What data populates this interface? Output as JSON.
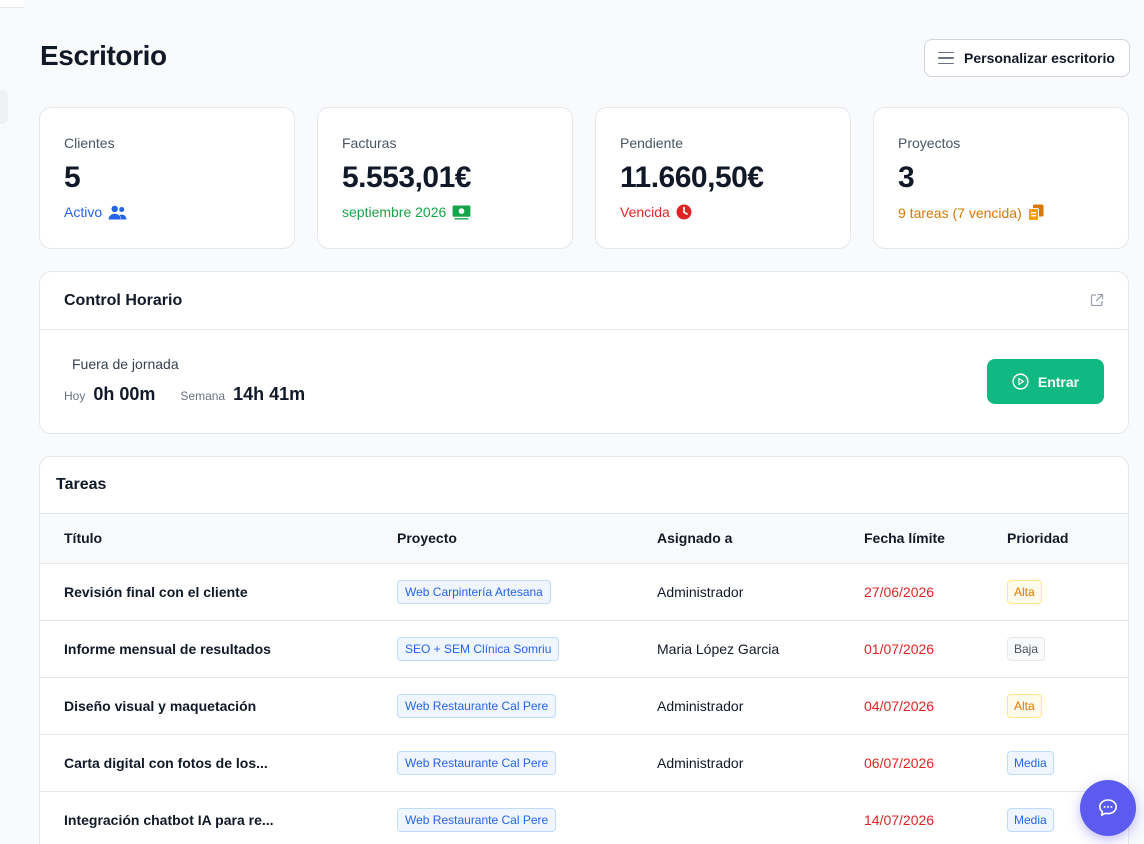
{
  "page": {
    "title": "Escritorio",
    "customize_label": "Personalizar escritorio"
  },
  "stats": [
    {
      "label": "Clientes",
      "value": "5",
      "sub": "Activo",
      "icon": "users-icon",
      "color": "#2563eb"
    },
    {
      "label": "Facturas",
      "value": "5.553,01€",
      "sub": "septiembre 2026",
      "icon": "money-bill-icon",
      "color": "#16a34a"
    },
    {
      "label": "Pendiente",
      "value": "11.660,50€",
      "sub": "Vencida",
      "icon": "clock-icon",
      "color": "#dc2626"
    },
    {
      "label": "Proyectos",
      "value": "3",
      "sub": "9 tareas (7 vencida)",
      "icon": "copy-icon",
      "color": "#d97706"
    }
  ],
  "time_control": {
    "title": "Control Horario",
    "status": "Fuera de jornada",
    "today_label": "Hoy",
    "today_value": "0h 00m",
    "week_label": "Semana",
    "week_value": "14h 41m",
    "enter_label": "Entrar"
  },
  "tasks": {
    "title": "Tareas",
    "columns": [
      "Título",
      "Proyecto",
      "Asignado a",
      "Fecha límite",
      "Prioridad"
    ],
    "rows": [
      {
        "title": "Revisión final con el cliente",
        "project": "Web Carpintería Artesana",
        "assignee": "Administrador",
        "due": "27/06/2026",
        "priority": "Alta"
      },
      {
        "title": "Informe mensual de resultados",
        "project": "SEO + SEM Clínica Somriu",
        "assignee": "Maria López Garcia",
        "due": "01/07/2026",
        "priority": "Baja"
      },
      {
        "title": "Diseño visual y maquetación",
        "project": "Web Restaurante Cal Pere",
        "assignee": "Administrador",
        "due": "04/07/2026",
        "priority": "Alta"
      },
      {
        "title": "Carta digital con fotos de los...",
        "project": "Web Restaurante Cal Pere",
        "assignee": "Administrador",
        "due": "06/07/2026",
        "priority": "Media"
      },
      {
        "title": "Integración chatbot IA para re...",
        "project": "Web Restaurante Cal Pere",
        "assignee": "",
        "due": "14/07/2026",
        "priority": "Media"
      }
    ]
  },
  "colors": {
    "accent_green": "#10b981",
    "chat_fab": "#5b5bf0"
  }
}
